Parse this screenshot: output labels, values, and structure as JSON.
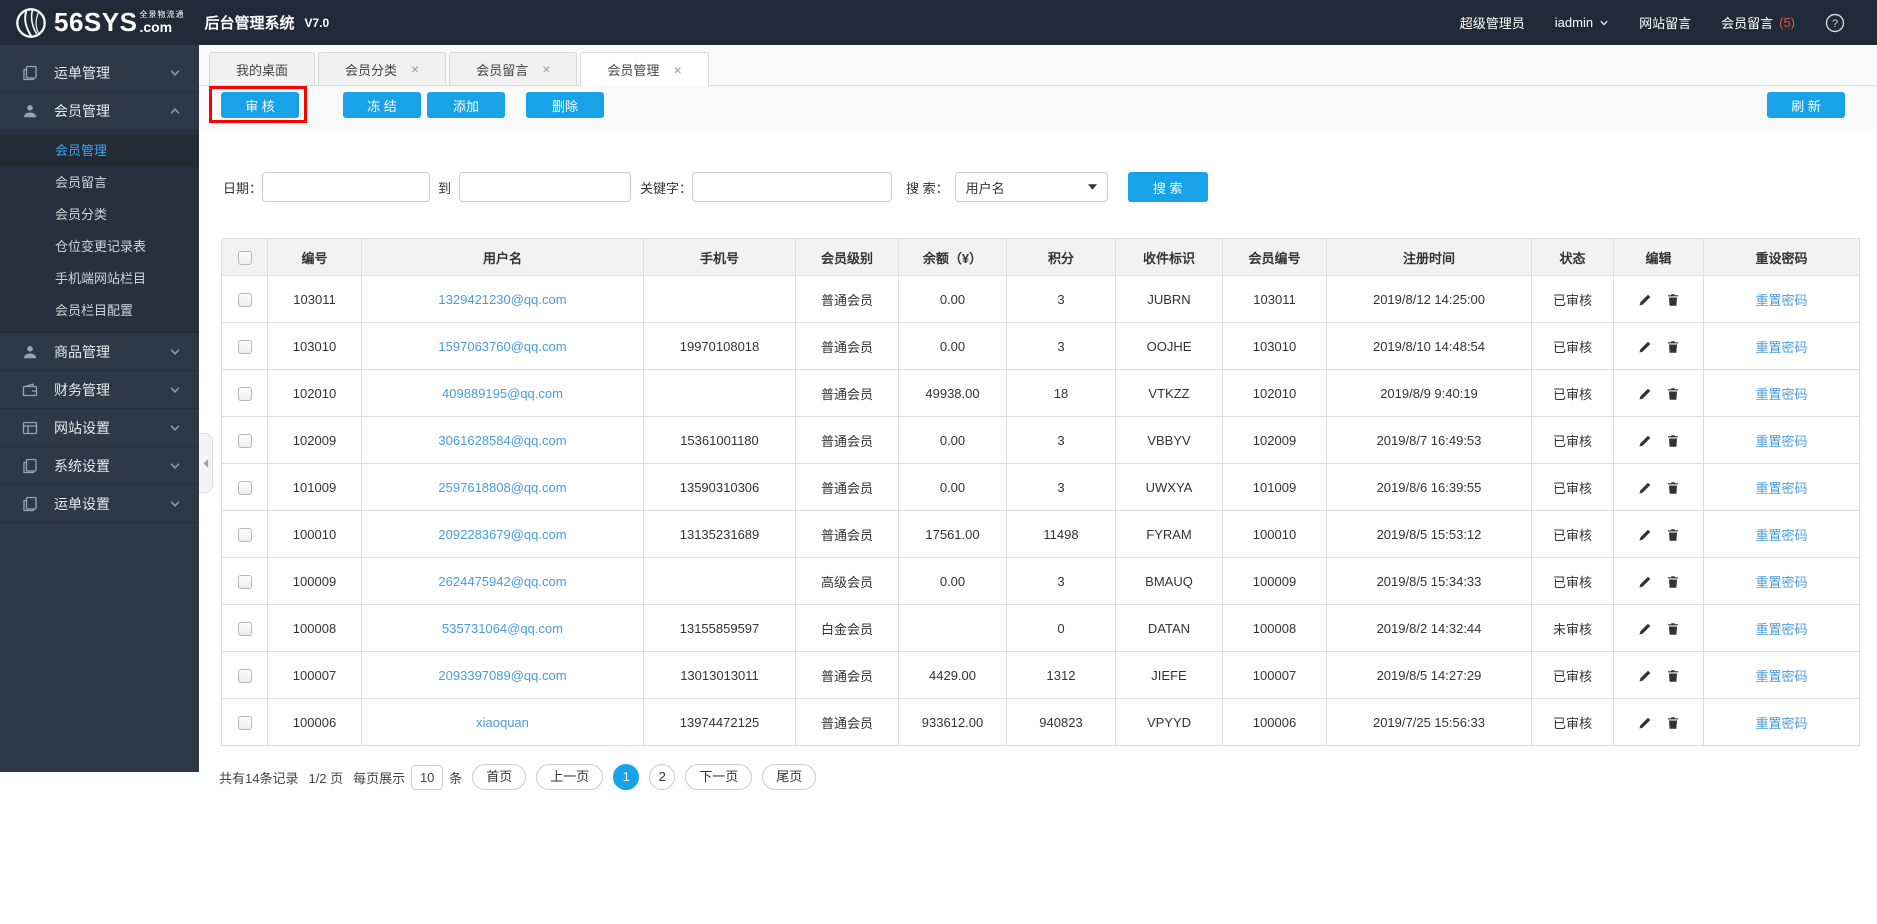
{
  "colors": {
    "accent": "#18a3e8",
    "link": "#4a9cdb",
    "annotation_box": "#ff0000",
    "badge_red": "#e8543f",
    "header_bg": "#202a38",
    "sidebar_bg": "#2e3948"
  },
  "header": {
    "logo_main": "56SYS",
    "logo_com": ".com",
    "logo_tagline": "全景物流通",
    "app_title": "后台管理系统",
    "version": "V7.0",
    "role": "超级管理员",
    "username": "iadmin",
    "site_messages": "网站留言",
    "member_messages": "会员留言",
    "member_message_count": "(5)"
  },
  "sidebar": {
    "groups": [
      {
        "slug": "waybill-management",
        "label": "运单管理",
        "icon": "doc",
        "expanded": false,
        "children": []
      },
      {
        "slug": "member-management",
        "label": "会员管理",
        "icon": "user",
        "expanded": true,
        "children": [
          {
            "slug": "member-management",
            "label": "会员管理",
            "active": true
          },
          {
            "slug": "member-messages",
            "label": "会员留言",
            "active": false
          },
          {
            "slug": "member-categories",
            "label": "会员分类",
            "active": false
          },
          {
            "slug": "warehouse-change-log",
            "label": "仓位变更记录表",
            "active": false
          },
          {
            "slug": "mobile-site-columns",
            "label": "手机端网站栏目",
            "active": false
          },
          {
            "slug": "member-column-config",
            "label": "会员栏目配置",
            "active": false
          }
        ]
      },
      {
        "slug": "product-management",
        "label": "商品管理",
        "icon": "user",
        "expanded": false,
        "children": []
      },
      {
        "slug": "finance-management",
        "label": "财务管理",
        "icon": "wallet",
        "expanded": false,
        "children": []
      },
      {
        "slug": "website-settings",
        "label": "网站设置",
        "icon": "window",
        "expanded": false,
        "children": []
      },
      {
        "slug": "system-settings",
        "label": "系统设置",
        "icon": "doc",
        "expanded": false,
        "children": []
      },
      {
        "slug": "waybill-settings",
        "label": "运单设置",
        "icon": "doc",
        "expanded": false,
        "children": []
      }
    ]
  },
  "tabs": [
    {
      "slug": "my-desktop",
      "label": "我的桌面",
      "closable": false,
      "active": false
    },
    {
      "slug": "member-categories",
      "label": "会员分类",
      "closable": true,
      "active": false
    },
    {
      "slug": "member-messages",
      "label": "会员留言",
      "closable": true,
      "active": false
    },
    {
      "slug": "member-management",
      "label": "会员管理",
      "closable": true,
      "active": true
    }
  ],
  "toolbar": {
    "buttons": [
      {
        "slug": "audit",
        "label": "审 核"
      },
      {
        "slug": "freeze",
        "label": "冻 结"
      },
      {
        "slug": "add",
        "label": "添加"
      },
      {
        "slug": "delete",
        "label": "删除"
      }
    ],
    "refresh_label": "刷 新"
  },
  "filters": {
    "date_label": "日期：",
    "to_label": "到",
    "keyword_label": "关键字：",
    "search_type_label": "搜 索：",
    "search_type_value": "用户名",
    "search_button": "搜 索"
  },
  "table": {
    "columns": [
      "",
      "编号",
      "用户名",
      "手机号",
      "会员级别",
      "余额（¥）",
      "积分",
      "收件标识",
      "会员编号",
      "注册时间",
      "状态",
      "编辑",
      "重设密码"
    ],
    "reset_label": "重置密码",
    "rows": [
      {
        "id": "103011",
        "username": "1329421230@qq.com",
        "phone": "",
        "level": "普通会员",
        "balance": "0.00",
        "points": "3",
        "code": "JUBRN",
        "member_no": "103011",
        "reg_time": "2019/8/12 14:25:00",
        "status": "已审核"
      },
      {
        "id": "103010",
        "username": "1597063760@qq.com",
        "phone": "19970108018",
        "level": "普通会员",
        "balance": "0.00",
        "points": "3",
        "code": "OOJHE",
        "member_no": "103010",
        "reg_time": "2019/8/10 14:48:54",
        "status": "已审核"
      },
      {
        "id": "102010",
        "username": "409889195@qq.com",
        "phone": "",
        "level": "普通会员",
        "balance": "49938.00",
        "points": "18",
        "code": "VTKZZ",
        "member_no": "102010",
        "reg_time": "2019/8/9 9:40:19",
        "status": "已审核"
      },
      {
        "id": "102009",
        "username": "3061628584@qq.com",
        "phone": "15361001180",
        "level": "普通会员",
        "balance": "0.00",
        "points": "3",
        "code": "VBBYV",
        "member_no": "102009",
        "reg_time": "2019/8/7 16:49:53",
        "status": "已审核"
      },
      {
        "id": "101009",
        "username": "2597618808@qq.com",
        "phone": "13590310306",
        "level": "普通会员",
        "balance": "0.00",
        "points": "3",
        "code": "UWXYA",
        "member_no": "101009",
        "reg_time": "2019/8/6 16:39:55",
        "status": "已审核"
      },
      {
        "id": "100010",
        "username": "2092283679@qq.com",
        "phone": "13135231689",
        "level": "普通会员",
        "balance": "17561.00",
        "points": "11498",
        "code": "FYRAM",
        "member_no": "100010",
        "reg_time": "2019/8/5 15:53:12",
        "status": "已审核"
      },
      {
        "id": "100009",
        "username": "2624475942@qq.com",
        "phone": "",
        "level": "高级会员",
        "balance": "0.00",
        "points": "3",
        "code": "BMAUQ",
        "member_no": "100009",
        "reg_time": "2019/8/5 15:34:33",
        "status": "已审核"
      },
      {
        "id": "100008",
        "username": "535731064@qq.com",
        "phone": "13155859597",
        "level": "白金会员",
        "balance": "",
        "points": "0",
        "code": "DATAN",
        "member_no": "100008",
        "reg_time": "2019/8/2 14:32:44",
        "status": "未审核"
      },
      {
        "id": "100007",
        "username": "2093397089@qq.com",
        "phone": "13013013011",
        "level": "普通会员",
        "balance": "4429.00",
        "points": "1312",
        "code": "JIEFE",
        "member_no": "100007",
        "reg_time": "2019/8/5 14:27:29",
        "status": "已审核"
      },
      {
        "id": "100006",
        "username": "xiaoquan",
        "phone": "13974472125",
        "level": "普通会员",
        "balance": "933612.00",
        "points": "940823",
        "code": "VPYYD",
        "member_no": "100006",
        "reg_time": "2019/7/25 15:56:33",
        "status": "已审核"
      }
    ]
  },
  "pagination": {
    "total_text": "共有14条记录",
    "page_indicator": "1/2 页",
    "per_page_prefix": "每页展示",
    "per_page_value": "10",
    "per_page_suffix": "条",
    "buttons": [
      {
        "slug": "first",
        "label": "首页",
        "active": false
      },
      {
        "slug": "prev",
        "label": "上一页",
        "active": false
      },
      {
        "slug": "page-1",
        "label": "1",
        "active": true
      },
      {
        "slug": "page-2",
        "label": "2",
        "active": false
      },
      {
        "slug": "next",
        "label": "下一页",
        "active": false
      },
      {
        "slug": "last",
        "label": "尾页",
        "active": false
      }
    ]
  }
}
